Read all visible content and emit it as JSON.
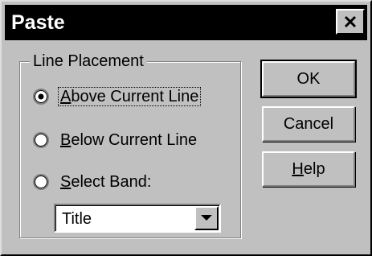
{
  "window": {
    "title": "Paste",
    "close_label": "×"
  },
  "line_placement": {
    "label": "Line Placement",
    "options": [
      {
        "mnemonic": "A",
        "rest": "bove Current Line",
        "selected": true
      },
      {
        "mnemonic": "B",
        "rest": "elow Current Line",
        "selected": false
      },
      {
        "mnemonic": "S",
        "rest": "elect Band:",
        "selected": false
      }
    ],
    "band": {
      "selected_value": "Title"
    }
  },
  "buttons": {
    "ok": {
      "label": "OK"
    },
    "cancel": {
      "label": "Cancel"
    },
    "help": {
      "mnemonic": "H",
      "rest": "elp"
    }
  }
}
